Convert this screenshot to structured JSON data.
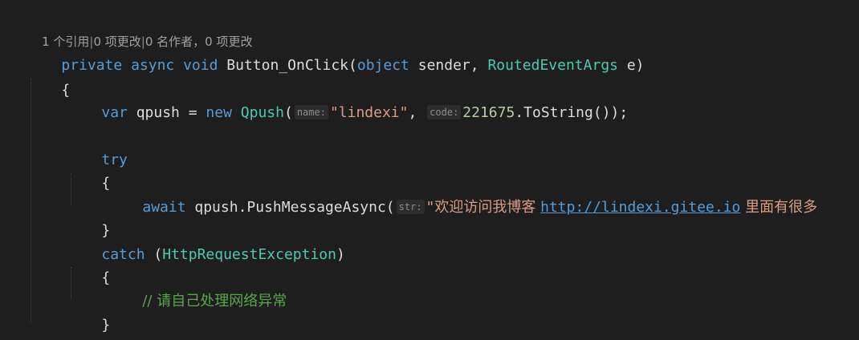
{
  "codelens": {
    "references": "1 个引用",
    "changes": "0 项更改",
    "authors": "0 名作者，0 项更改",
    "separator": "|"
  },
  "code": {
    "l1": {
      "kw_private": "private",
      "kw_async": "async",
      "kw_void": "void",
      "method_name": "Button_OnClick",
      "paren_open": "(",
      "kw_object": "object",
      "param_sender": " sender, ",
      "type_args": "RoutedEventArgs",
      "param_e": " e)"
    },
    "l2": {
      "brace": "{"
    },
    "l3": {
      "kw_var": "var",
      "var_name": " qpush = ",
      "kw_new": "new",
      "type_qpush": "Qpush",
      "paren_open": "(",
      "hint_name": "name:",
      "str_name": "\"lindexi\"",
      "comma": ", ",
      "hint_code": "code:",
      "num_code": "221675",
      "tostring": ".ToString());"
    },
    "l5": {
      "kw_try": "try"
    },
    "l6": {
      "brace": "{"
    },
    "l7": {
      "kw_await": "await",
      "call": " qpush.PushMessageAsync(",
      "hint_str": "str:",
      "str_open": "\"",
      "str_text": "欢迎访问我博客 ",
      "link": "http://lindexi.gitee.io",
      "str_rest": " 里面有",
      "trailing": "很多"
    },
    "l8": {
      "brace": "}"
    },
    "l9": {
      "kw_catch": "catch",
      "paren_open": " (",
      "type_exception": "HttpRequestException",
      "paren_close": ")"
    },
    "l10": {
      "brace": "{"
    },
    "l11": {
      "comment": "// 请自己处理网络异常"
    },
    "l12": {
      "brace": "}"
    },
    "l13": {
      "brace": "}"
    }
  },
  "colors": {
    "background": "#1e1e1e",
    "keyword": "#569cd6",
    "type": "#4ec9b0",
    "string": "#d69d85",
    "comment": "#57a64a",
    "text": "#dcdcdc"
  }
}
